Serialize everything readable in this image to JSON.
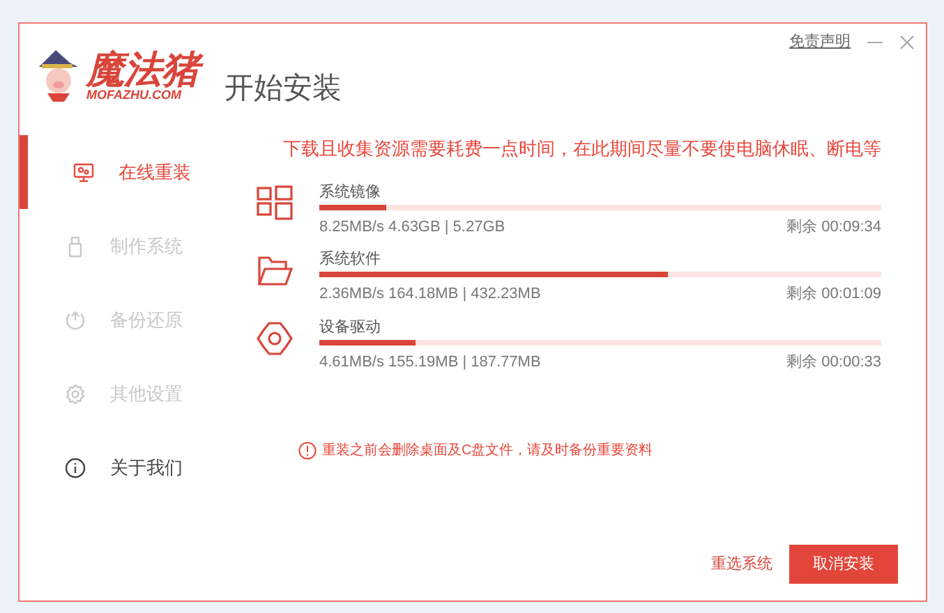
{
  "header": {
    "logo_name": "魔法猪",
    "logo_domain": "MOFAZHU.COM",
    "title": "开始安装",
    "disclaimer_link": "免责声明"
  },
  "sidebar": {
    "items": [
      {
        "kind": "monitor",
        "label": "在线重装",
        "selected": true,
        "disabled": false
      },
      {
        "kind": "usb",
        "label": "制作系统",
        "selected": false,
        "disabled": true
      },
      {
        "kind": "backup",
        "label": "备份还原",
        "selected": false,
        "disabled": true
      },
      {
        "kind": "settings",
        "label": "其他设置",
        "selected": false,
        "disabled": true
      },
      {
        "kind": "info",
        "label": "关于我们",
        "selected": false,
        "disabled": false
      }
    ]
  },
  "notice": "下载且收集资源需要耗费一点时间，在此期间尽量不要使电脑休眠、断电等",
  "downloads": [
    {
      "kind": "windows",
      "name": "系统镜像",
      "level": 0.12,
      "stats": "8.25MB/s 4.63GB | 5.27GB",
      "remaining": "剩余 00:09:34"
    },
    {
      "kind": "folder",
      "name": "系统软件",
      "level": 0.62,
      "stats": "2.36MB/s 164.18MB | 432.23MB",
      "remaining": "剩余 00:01:09"
    },
    {
      "kind": "gear",
      "name": "设备驱动",
      "level": 0.17,
      "stats": "4.61MB/s 155.19MB | 187.77MB",
      "remaining": "剩余 00:00:33"
    }
  ],
  "warning": "重装之前会删除桌面及C盘文件，请及时备份重要资料",
  "buttons": {
    "reselect": "重选系统",
    "cancel": "取消安装"
  }
}
